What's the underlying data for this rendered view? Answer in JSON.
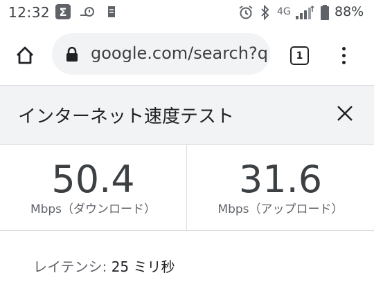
{
  "status_bar": {
    "time": "12:32",
    "network": "4G",
    "battery": "88%"
  },
  "toolbar": {
    "url": "google.com/search?q",
    "tab_count": "1"
  },
  "speed_test": {
    "title": "インターネット速度テスト",
    "download": {
      "value": "50.4",
      "label": "Mbps（ダウンロード）"
    },
    "upload": {
      "value": "31.6",
      "label": "Mbps（アップロード）"
    },
    "latency": {
      "label": "レイテンシ:",
      "value": "25 ミリ秒"
    }
  },
  "icons": {
    "status": [
      "sigma-icon",
      "notification-icon",
      "sim-icon",
      "alarm-icon",
      "bluetooth-icon",
      "signal-icon",
      "battery-icon"
    ],
    "toolbar": [
      "home-icon",
      "lock-icon",
      "tabs-icon",
      "more-vert-icon"
    ],
    "card": [
      "close-icon"
    ]
  }
}
